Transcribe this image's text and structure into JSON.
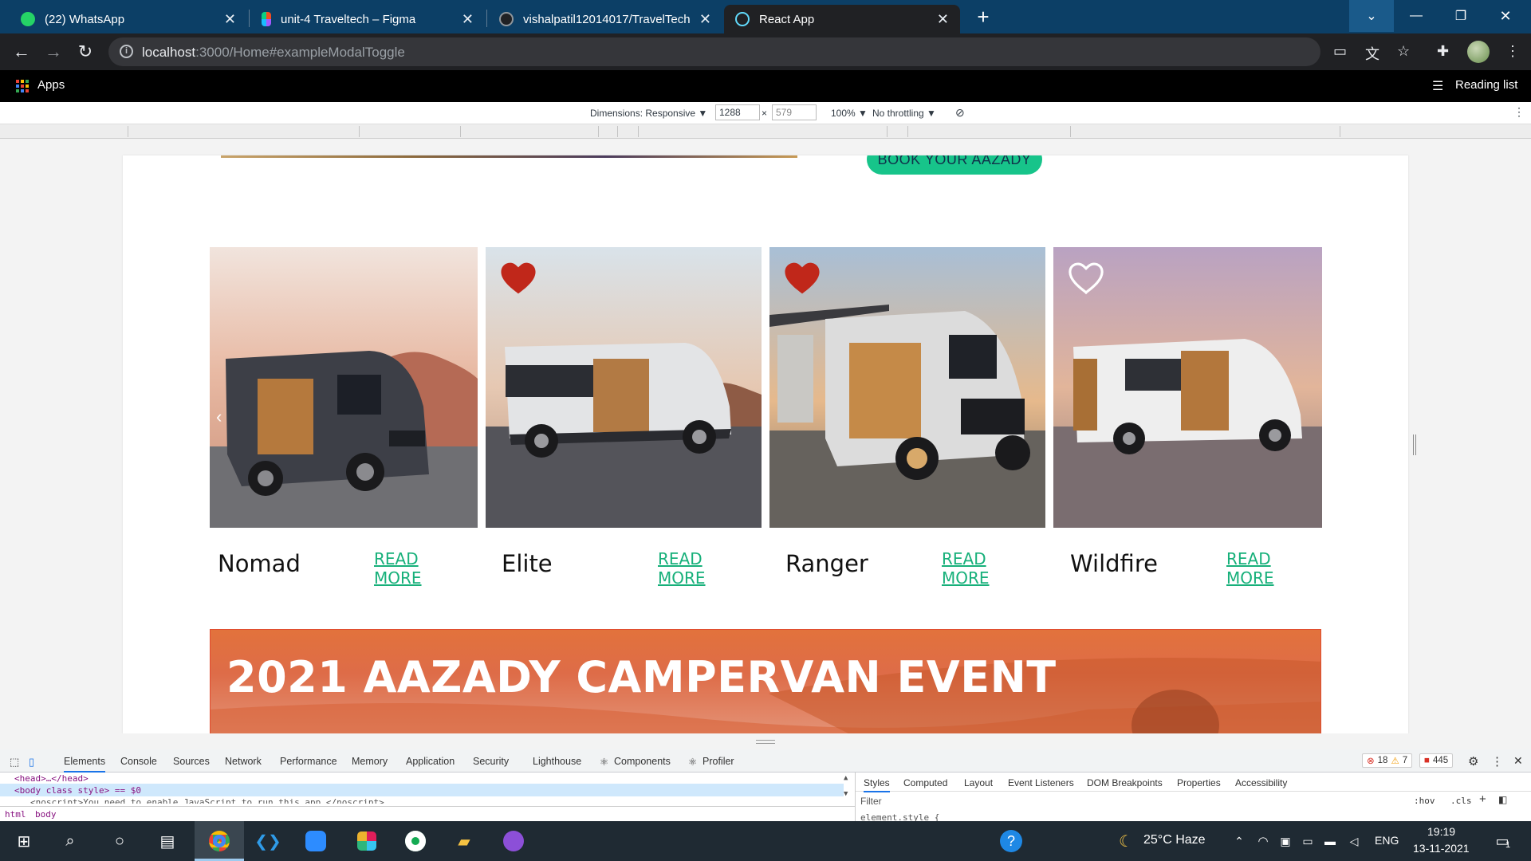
{
  "browser": {
    "tabs": [
      {
        "title": "(22) WhatsApp",
        "badge": "22",
        "color": "#25d366"
      },
      {
        "title": "unit-4 Traveltech – Figma",
        "color": "#f24e1e"
      },
      {
        "title": "vishalpatil12014017/TravelTech",
        "color": "#24292f"
      },
      {
        "title": "React App",
        "color": "#61dafb"
      }
    ],
    "new_tab": "+",
    "url_host": "localhost",
    "url_path": ":3000/Home#exampleModalToggle",
    "bookmarks": {
      "apps": "Apps",
      "reading_list": "Reading list"
    }
  },
  "device_toolbar": {
    "dimensions_label": "Dimensions: Responsive ▼",
    "width": "1288",
    "x": "×",
    "height": "579",
    "zoom": "100% ▼",
    "throttling": "No throttling ▼"
  },
  "page": {
    "book_button": "BOOK YOUR AAZADY",
    "vans": [
      {
        "name": "Nomad",
        "link": "READ MORE",
        "favorite": "none"
      },
      {
        "name": "Elite",
        "link": "READ MORE",
        "favorite": "filled"
      },
      {
        "name": "Ranger",
        "link": "READ MORE",
        "favorite": "filled"
      },
      {
        "name": "Wildfire",
        "link": "READ MORE",
        "favorite": "outline"
      }
    ],
    "event_title": "2021 AAZADY CAMPERVAN EVENT",
    "colors": {
      "accent": "#17c48a",
      "link": "#17b07a",
      "heart": "#c0271a"
    }
  },
  "devtools": {
    "tabs": [
      "Elements",
      "Console",
      "Sources",
      "Network",
      "Performance",
      "Memory",
      "Application",
      "Security",
      "Lighthouse",
      "Components",
      "Profiler"
    ],
    "errors": "18",
    "warnings": "7",
    "issues": "445",
    "code": {
      "head": "<head>…</head>",
      "body": "<body class style> == $0",
      "noscript": "<noscript>You need to enable JavaScript to run this app.</noscript>"
    },
    "breadcrumb": [
      "html",
      "body"
    ],
    "styles_tabs": [
      "Styles",
      "Computed",
      "Layout",
      "Event Listeners",
      "DOM Breakpoints",
      "Properties",
      "Accessibility"
    ],
    "filter_placeholder": "Filter",
    "hov": ":hov",
    "cls": ".cls",
    "element_style": "element.style {"
  },
  "taskbar": {
    "weather": "25°C  Haze",
    "lang": "ENG",
    "time": "19:19",
    "date": "13-11-2021",
    "notifications": "1"
  }
}
